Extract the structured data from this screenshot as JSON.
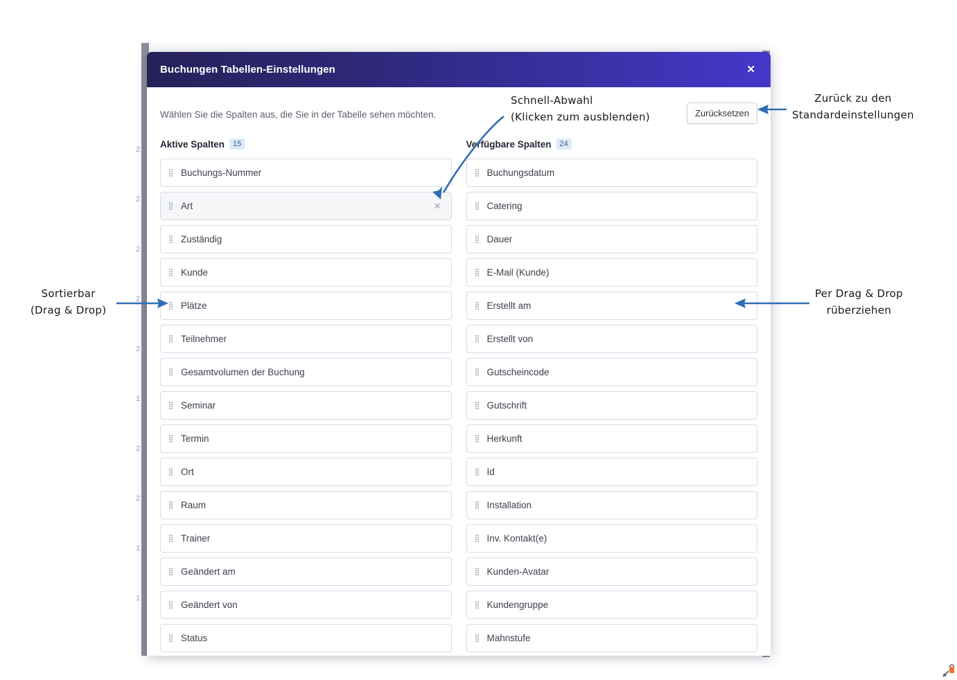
{
  "modal": {
    "title": "Buchungen Tabellen-Einstellungen",
    "close_label": "✕",
    "subtitle": "Wählen Sie die Spalten aus, die Sie in der Tabelle sehen möchten.",
    "reset_label": "Zurücksetzen",
    "accent_header_from": "#262159",
    "accent_header_to": "#4338ca",
    "badge_bg": "#dceafb",
    "badge_text": "#3f5b83"
  },
  "active_columns": {
    "heading": "Aktive Spalten",
    "count": "15",
    "items": [
      {
        "label": "Buchungs-Nummer",
        "removable": false,
        "highlighted": false
      },
      {
        "label": "Art",
        "removable": true,
        "highlighted": true
      },
      {
        "label": "Zuständig",
        "removable": false,
        "highlighted": false
      },
      {
        "label": "Kunde",
        "removable": false,
        "highlighted": false
      },
      {
        "label": "Plätze",
        "removable": false,
        "highlighted": false
      },
      {
        "label": "Teilnehmer",
        "removable": false,
        "highlighted": false
      },
      {
        "label": "Gesamtvolumen der Buchung",
        "removable": false,
        "highlighted": false
      },
      {
        "label": "Seminar",
        "removable": false,
        "highlighted": false
      },
      {
        "label": "Termin",
        "removable": false,
        "highlighted": false
      },
      {
        "label": "Ort",
        "removable": false,
        "highlighted": false
      },
      {
        "label": "Raum",
        "removable": false,
        "highlighted": false
      },
      {
        "label": "Trainer",
        "removable": false,
        "highlighted": false
      },
      {
        "label": "Geändert am",
        "removable": false,
        "highlighted": false
      },
      {
        "label": "Geändert von",
        "removable": false,
        "highlighted": false
      },
      {
        "label": "Status",
        "removable": false,
        "highlighted": false
      }
    ]
  },
  "available_columns": {
    "heading": "Verfügbare Spalten",
    "count": "24",
    "items": [
      {
        "label": "Buchungsdatum"
      },
      {
        "label": "Catering"
      },
      {
        "label": "Dauer"
      },
      {
        "label": "E-Mail (Kunde)"
      },
      {
        "label": "Erstellt am"
      },
      {
        "label": "Erstellt von"
      },
      {
        "label": "Gutscheincode"
      },
      {
        "label": "Gutschrift"
      },
      {
        "label": "Herkunft"
      },
      {
        "label": "Id"
      },
      {
        "label": "Installation"
      },
      {
        "label": "Inv. Kontakt(e)"
      },
      {
        "label": "Kunden-Avatar"
      },
      {
        "label": "Kundengruppe"
      },
      {
        "label": "Mahnstufe"
      }
    ]
  },
  "annotations": {
    "reset_line1": "Zurück zu den",
    "reset_line2": "Standardeinstellungen",
    "quick_line1": "Schnell-Abwahl",
    "quick_line2": "(Klicken zum ausblenden)",
    "sort_line1": "Sortierbar",
    "sort_line2": "(Drag & Drop)",
    "drag_line1": "Per Drag & Drop",
    "drag_line2": "rüberziehen",
    "arrow_color": "#2e6db4"
  },
  "background": {
    "left_numbers": [
      "2",
      "2",
      "2",
      "2",
      "2",
      "1",
      "2",
      "2",
      "1",
      "1"
    ],
    "badge_color": "#5e8c43",
    "scrollbar_color": "#8d8f9c"
  }
}
